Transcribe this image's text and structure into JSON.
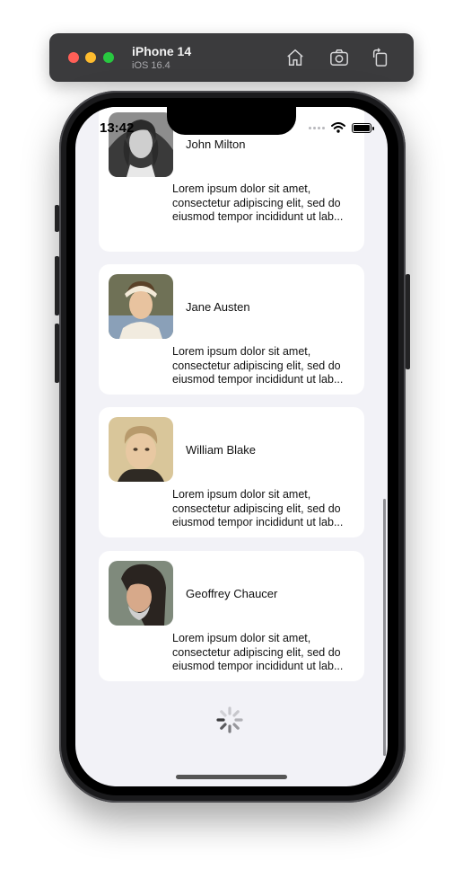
{
  "simulator": {
    "device_name": "iPhone 14",
    "os_version": "iOS 16.4",
    "buttons": [
      "home-icon",
      "screenshot-icon",
      "rotate-icon"
    ]
  },
  "status_bar": {
    "time": "13:42"
  },
  "authors": [
    {
      "name": "John Milton",
      "description": [
        "Lorem ipsum dolor sit amet,",
        "consectetur adipiscing elit, sed do",
        "eiusmod tempor incididunt ut lab..."
      ]
    },
    {
      "name": "Jane Austen",
      "description": [
        "Lorem ipsum dolor sit amet,",
        "consectetur adipiscing elit, sed do",
        "eiusmod tempor incididunt ut lab..."
      ]
    },
    {
      "name": "William Blake",
      "description": [
        "Lorem ipsum dolor sit amet,",
        "consectetur adipiscing elit, sed do",
        "eiusmod tempor incididunt ut lab..."
      ]
    },
    {
      "name": "Geoffrey Chaucer",
      "description": [
        "Lorem ipsum dolor sit amet,",
        "consectetur adipiscing elit, sed do",
        "eiusmod tempor incididunt ut lab..."
      ]
    }
  ],
  "colors": {
    "background": "#f2f2f7",
    "card": "#ffffff",
    "title_bar": "#3b3b3d"
  }
}
